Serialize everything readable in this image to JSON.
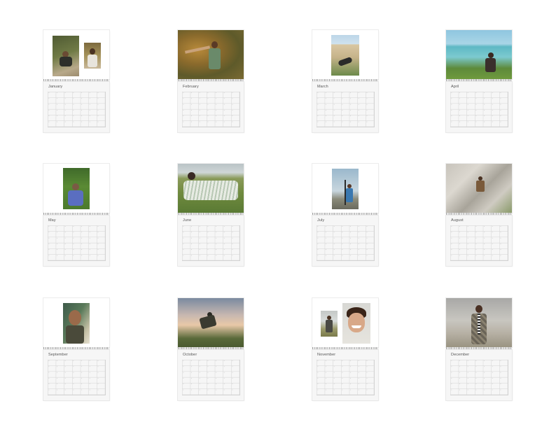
{
  "calendar": {
    "months": [
      {
        "name": "January"
      },
      {
        "name": "February"
      },
      {
        "name": "March"
      },
      {
        "name": "April"
      },
      {
        "name": "May"
      },
      {
        "name": "June"
      },
      {
        "name": "July"
      },
      {
        "name": "August"
      },
      {
        "name": "September"
      },
      {
        "name": "October"
      },
      {
        "name": "November"
      },
      {
        "name": "December"
      }
    ]
  }
}
